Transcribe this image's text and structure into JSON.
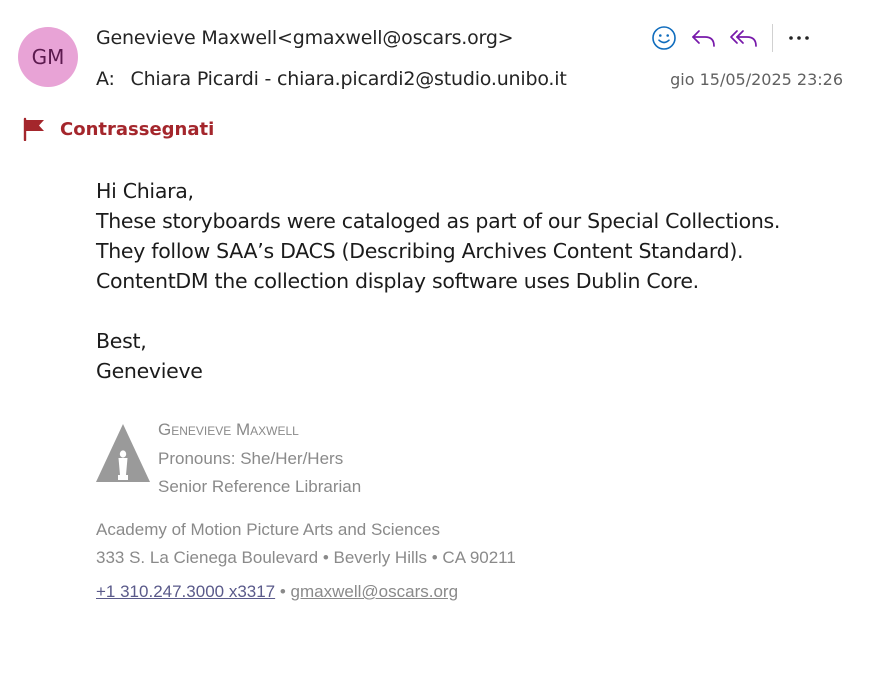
{
  "header": {
    "avatar_initials": "GM",
    "sender": "Genevieve Maxwell<gmaxwell@oscars.org>",
    "to_label": "A:",
    "recipient": "Chiara Picardi - chiara.picardi2@studio.unibo.it",
    "date": "gio 15/05/2025 23:26"
  },
  "actions": {
    "emoji_icon": "smiley-icon",
    "reply_icon": "reply-icon",
    "reply_all_icon": "reply-all-icon",
    "more_icon": "more-icon"
  },
  "flag": {
    "label": "Contrassegnati"
  },
  "body": {
    "greeting": "Hi Chiara,",
    "lines": [
      "These storyboards were cataloged as part of our Special Collections.",
      "They follow SAA’s DACS (Describing Archives Content Standard).",
      "ContentDM the collection display software uses Dublin Core."
    ],
    "closing": "Best,",
    "signoff": "Genevieve"
  },
  "signature": {
    "name": "Genevieve Maxwell",
    "pronouns": "Pronouns: She/Her/Hers",
    "title": "Senior Reference Librarian",
    "org": "Academy of Motion Picture Arts and Sciences",
    "address": "333 S. La Cienega Boulevard • Beverly Hills • CA 90211",
    "phone": "+1 310.247.3000 x3317",
    "separator": " • ",
    "email": "gmaxwell@oscars.org"
  },
  "colors": {
    "avatar_bg": "#e8a3d6",
    "flag": "#a4262c",
    "action_blue": "#0f6cbd",
    "action_purple": "#7719aa",
    "signature_gray": "#8a8a8a"
  }
}
